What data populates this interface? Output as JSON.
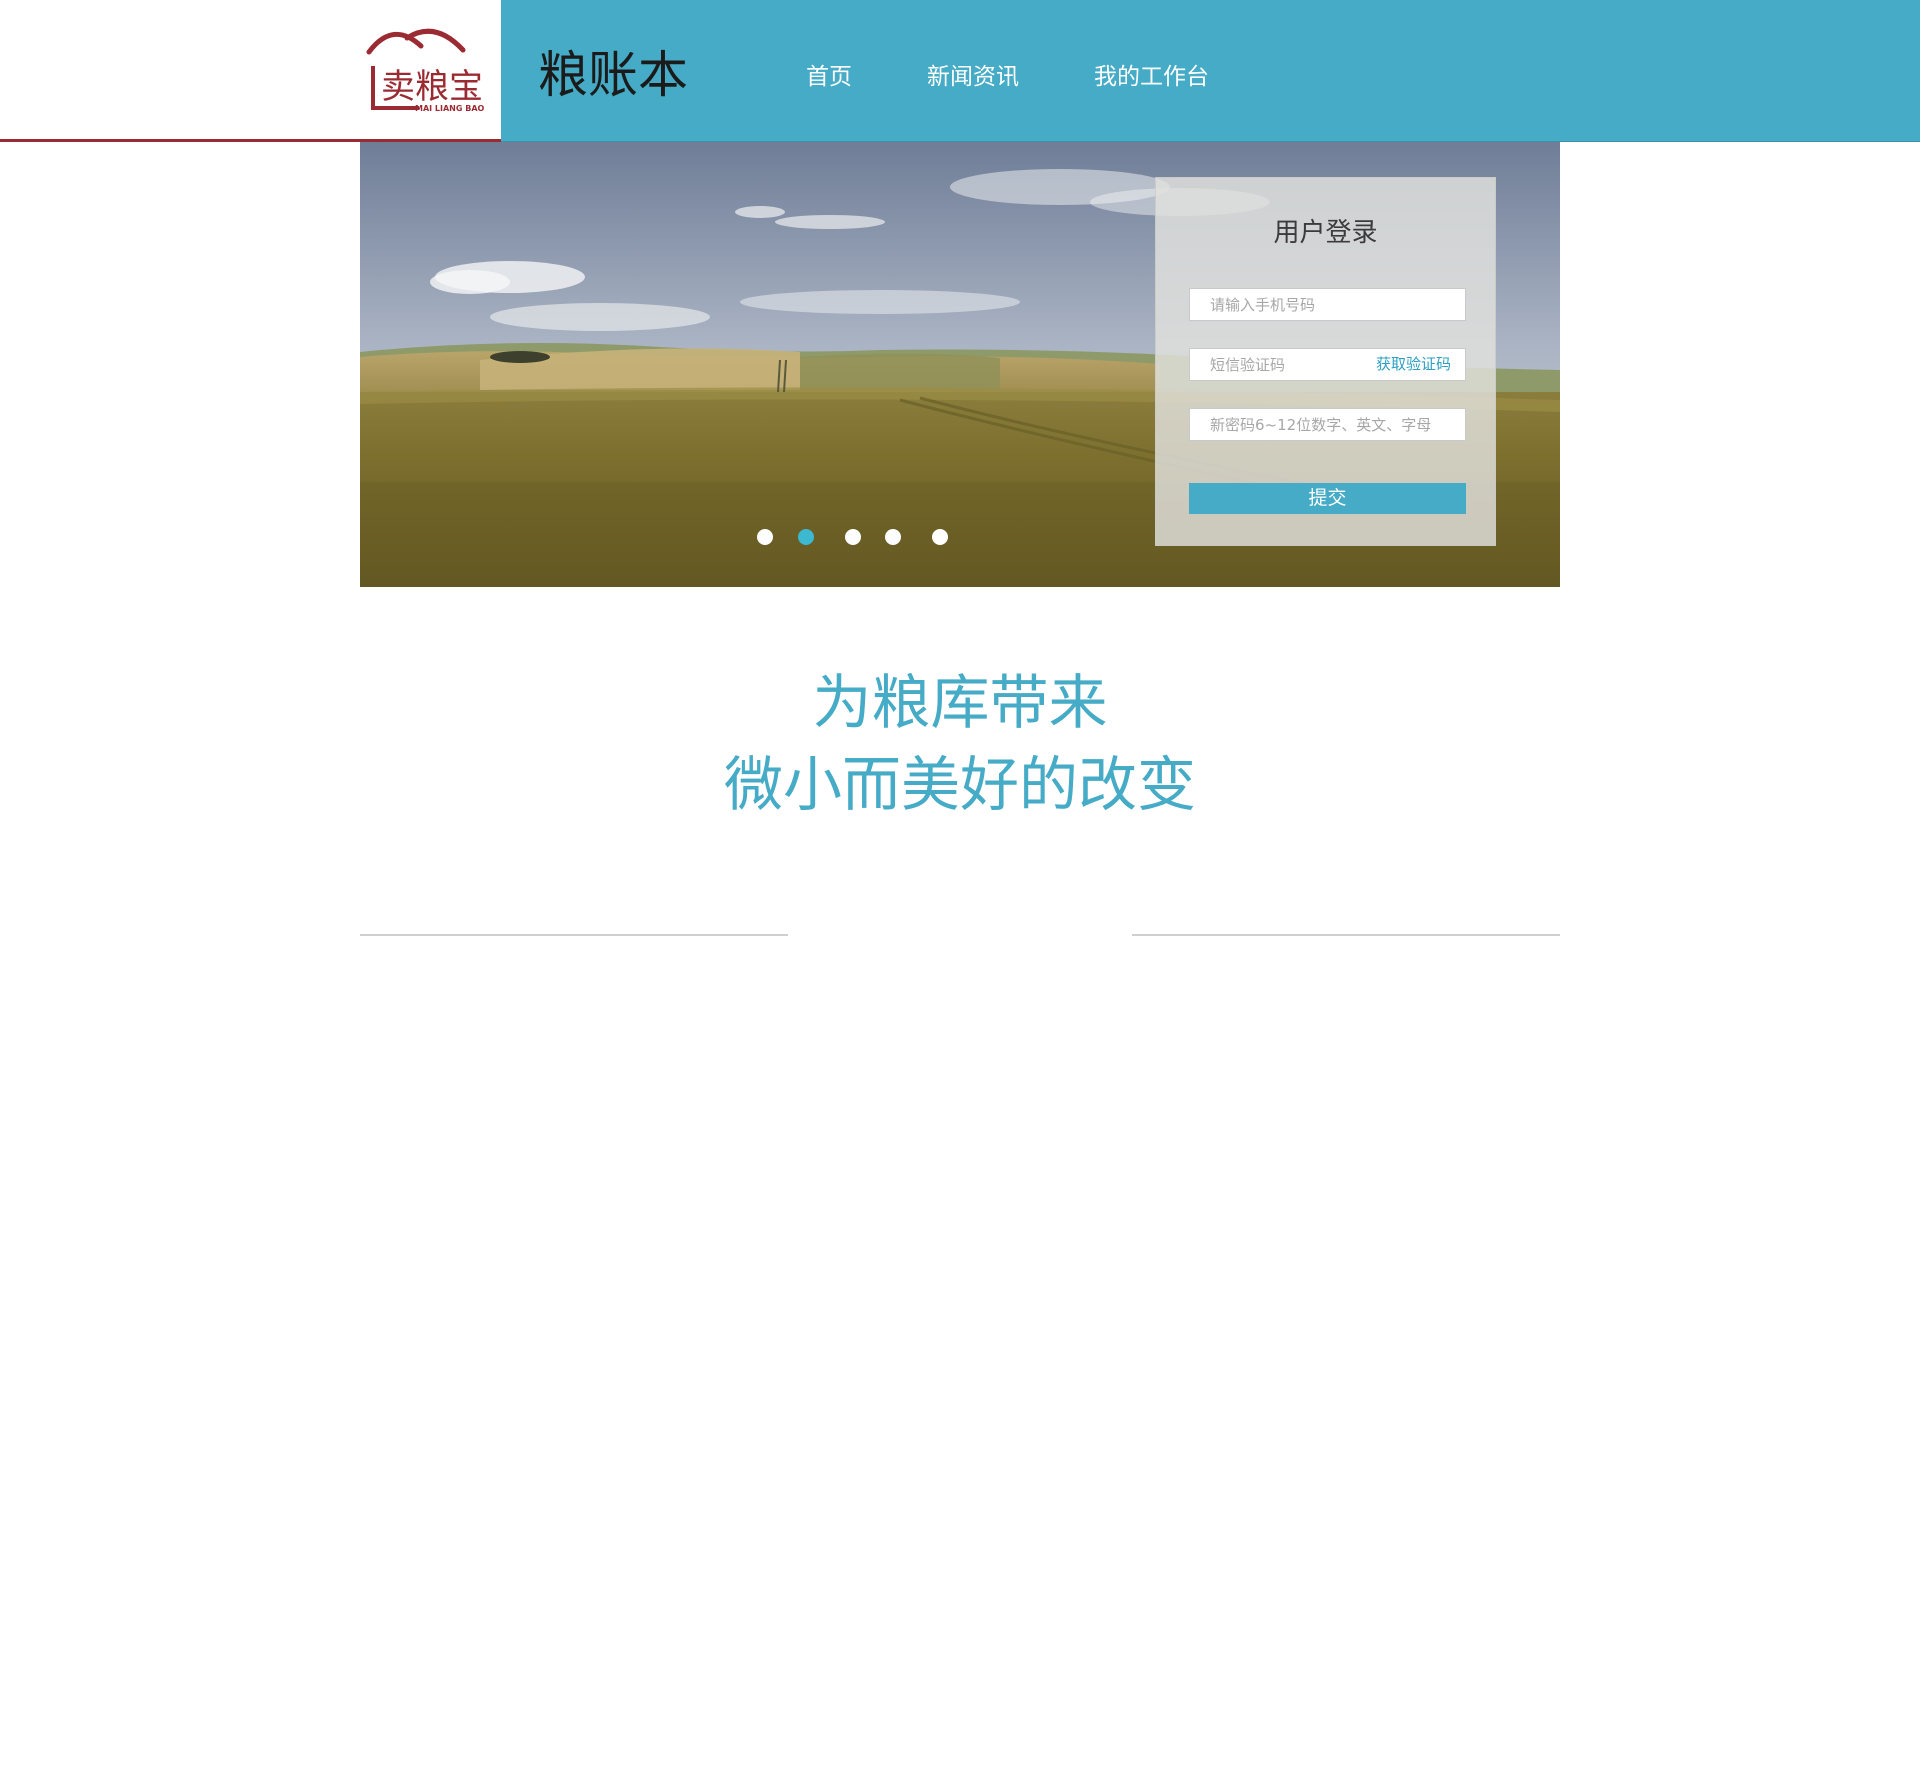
{
  "header": {
    "logo_text": "卖粮宝",
    "logo_subtext": "MAI LIANG BAO",
    "brand_title": "粮账本",
    "nav": [
      {
        "label": "首页"
      },
      {
        "label": "新闻资讯"
      },
      {
        "label": "我的工作台"
      }
    ]
  },
  "banner": {
    "carousel": {
      "slide_count": 5,
      "active_index": 1
    }
  },
  "login": {
    "title": "用户登录",
    "phone_placeholder": "请输入手机号码",
    "sms_placeholder": "短信验证码",
    "get_code_label": "获取验证码",
    "password_placeholder": "新密码6~12位数字、英文、字母",
    "submit_label": "提交"
  },
  "slogan": {
    "line1": "为粮库带来",
    "line2": "微小而美好的改变"
  },
  "colors": {
    "primary": "#45abc6",
    "brand_red": "#9b2b32",
    "dot_active": "#3cb8d0"
  }
}
